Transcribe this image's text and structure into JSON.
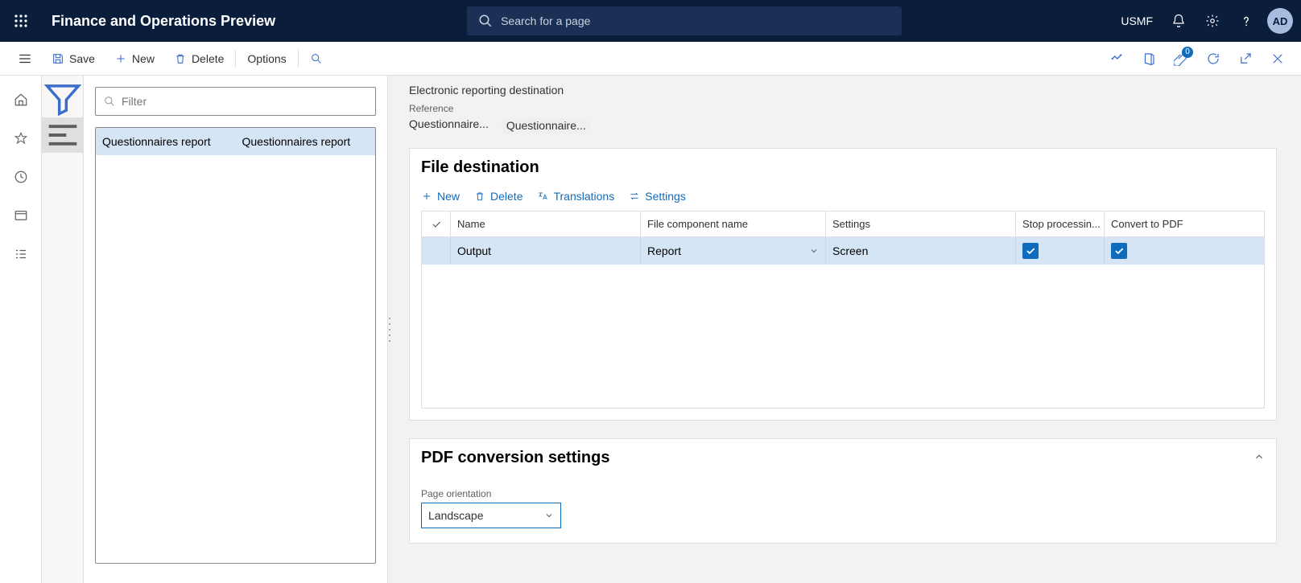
{
  "header": {
    "app_title": "Finance and Operations Preview",
    "search_placeholder": "Search for a page",
    "company": "USMF",
    "avatar": "AD",
    "notification_count": "0"
  },
  "action_bar": {
    "save": "Save",
    "new": "New",
    "delete": "Delete",
    "options": "Options"
  },
  "records": {
    "filter_placeholder": "Filter",
    "rows": [
      {
        "a": "Questionnaires report",
        "b": "Questionnaires report"
      }
    ]
  },
  "main": {
    "page_title": "Electronic reporting destination",
    "reference_label": "Reference",
    "reference_values": [
      "Questionnaire...",
      "Questionnaire..."
    ],
    "file_destination": {
      "title": "File destination",
      "toolbar": {
        "new": "New",
        "delete": "Delete",
        "translations": "Translations",
        "settings": "Settings"
      },
      "columns": {
        "name": "Name",
        "fcn": "File component name",
        "settings": "Settings",
        "stop": "Stop processin...",
        "pdf": "Convert to PDF"
      },
      "rows": [
        {
          "name": "Output",
          "fcn": "Report",
          "settings": "Screen",
          "stop": true,
          "pdf": true
        }
      ]
    },
    "pdf_settings": {
      "title": "PDF conversion settings",
      "page_orientation_label": "Page orientation",
      "page_orientation_value": "Landscape"
    }
  }
}
